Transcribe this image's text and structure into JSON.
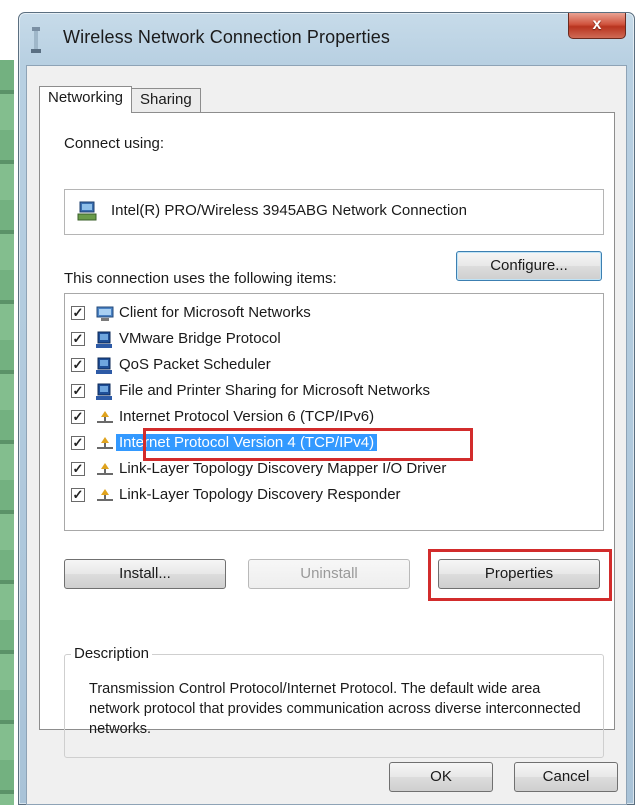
{
  "window": {
    "title": "Wireless Network Connection Properties",
    "close_glyph": "x"
  },
  "tabs": [
    {
      "label": "Networking",
      "active": true
    },
    {
      "label": "Sharing",
      "active": false
    }
  ],
  "connect_using": {
    "label": "Connect using:",
    "device": "Intel(R) PRO/Wireless 3945ABG Network Connection",
    "device_icon": "network-adapter-icon"
  },
  "buttons": {
    "configure": "Configure...",
    "install": "Install...",
    "uninstall": "Uninstall",
    "properties": "Properties",
    "ok": "OK",
    "cancel": "Cancel"
  },
  "items_label": "This connection uses the following items:",
  "items": [
    {
      "label": "Client for Microsoft Networks",
      "checked": true,
      "icon": "network-client-icon"
    },
    {
      "label": "VMware Bridge Protocol",
      "checked": true,
      "icon": "computer-service-icon"
    },
    {
      "label": "QoS Packet Scheduler",
      "checked": true,
      "icon": "computer-service-icon"
    },
    {
      "label": "File and Printer Sharing for Microsoft Networks",
      "checked": true,
      "icon": "computer-service-icon"
    },
    {
      "label": "Internet Protocol Version 6 (TCP/IPv6)",
      "checked": true,
      "icon": "protocol-icon"
    },
    {
      "label": "Internet Protocol Version 4 (TCP/IPv4)",
      "checked": true,
      "icon": "protocol-icon",
      "selected": true
    },
    {
      "label": "Link-Layer Topology Discovery Mapper I/O Driver",
      "checked": true,
      "icon": "protocol-icon"
    },
    {
      "label": "Link-Layer Topology Discovery Responder",
      "checked": true,
      "icon": "protocol-icon"
    }
  ],
  "description": {
    "title": "Description",
    "text": "Transmission Control Protocol/Internet Protocol. The default wide area network protocol that provides communication across diverse interconnected networks."
  },
  "colors": {
    "highlight": "#d22c2c",
    "selection": "#3399ff"
  }
}
